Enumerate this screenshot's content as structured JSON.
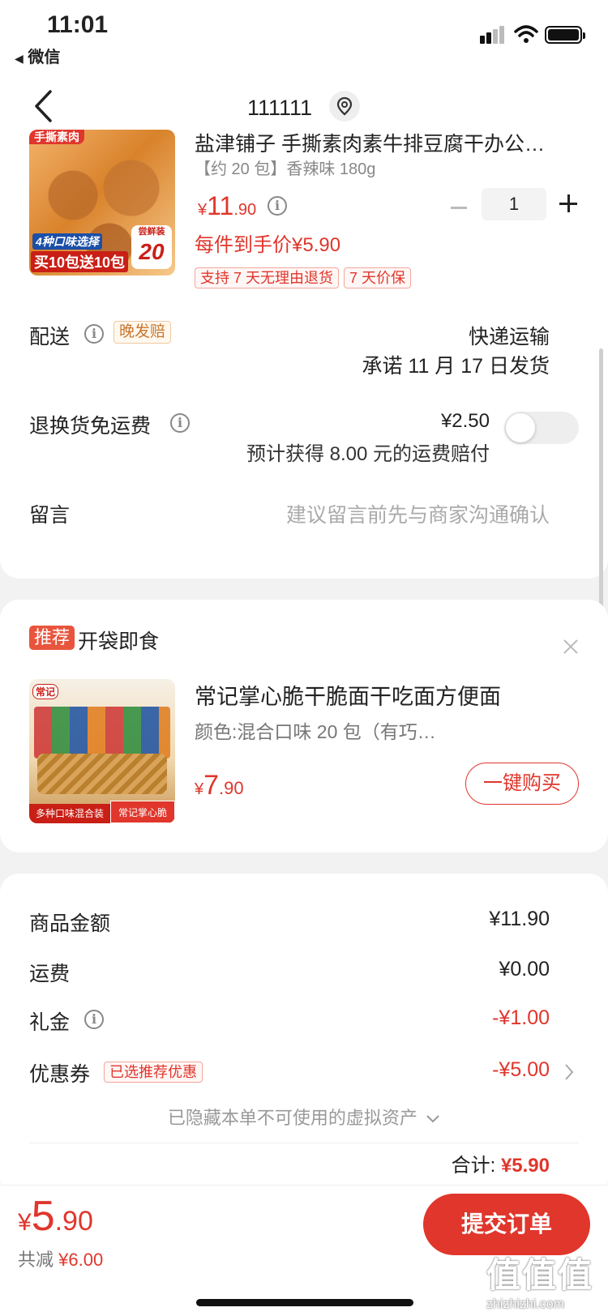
{
  "status_bar": {
    "time": "11:01",
    "back_app": "微信"
  },
  "nav": {
    "title": "111111"
  },
  "product": {
    "title": "盐津铺子 手撕素肉素牛排豆腐干办公…",
    "spec": "【约 20 包】香辣味 180g",
    "price_symbol": "¥",
    "price_int": "11",
    "price_dec": ".90",
    "final_price": "每件到手价¥5.90",
    "qty": "1",
    "tags": [
      "支持 7 天无理由退货",
      "7 天价保"
    ],
    "image_text": {
      "top": "手撕素肉",
      "flavors": "4种口味选择",
      "promo": "买10包送10包",
      "badge_top": "尝鲜装",
      "badge_num": "20"
    }
  },
  "delivery": {
    "label": "配送",
    "badge": "晚发赔",
    "method": "快递运输",
    "promise": "承诺 11 月 17 日发货"
  },
  "return_fee": {
    "label": "退换货免运费",
    "price": "¥2.50",
    "note": "预计获得 8.00 元的运费赔付",
    "toggle_on": false
  },
  "message": {
    "label": "留言",
    "placeholder": "建议留言前先与商家沟通确认"
  },
  "recommend": {
    "badge": "推荐",
    "title": "开袋即食",
    "item_title": "常记掌心脆干脆面干吃面方便面",
    "item_spec": "颜色:混合口味 20 包（有巧…",
    "price_symbol": "¥",
    "price_int": "7",
    "price_dec": ".90",
    "buy_label": "一键购买",
    "image_text": {
      "brand": "常记",
      "bottom_left": "多种口味混合装",
      "bottom_right": "常记掌心脆"
    }
  },
  "summary": {
    "goods_label": "商品金额",
    "goods_value": "¥11.90",
    "shipping_label": "运费",
    "shipping_value": "¥0.00",
    "gift_label": "礼金",
    "gift_value": "-¥1.00",
    "coupon_label": "优惠券",
    "coupon_badge": "已选推荐优惠",
    "coupon_value": "-¥5.00",
    "hidden_note": "已隐藏本单不可使用的虚拟资产",
    "total_label": "合计:",
    "total_value": "¥5.90"
  },
  "bottom": {
    "price_symbol": "¥",
    "price_int": "5",
    "price_dec": ".90",
    "saved_label": "共减",
    "saved_value": "¥6.00",
    "submit_label": "提交订单"
  },
  "watermark": {
    "chars": "值值值",
    "url": "zhizhizhi.com"
  },
  "colors": {
    "accent": "#e0362c",
    "background": "#f2f2f2"
  }
}
